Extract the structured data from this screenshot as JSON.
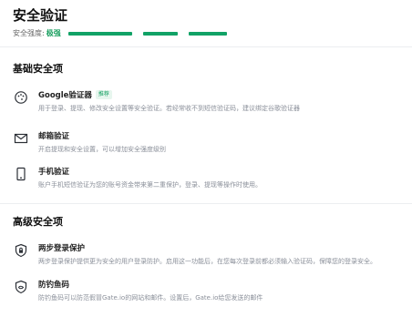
{
  "page": {
    "title": "安全验证",
    "strength_label": "安全强度:",
    "strength_value": "极强",
    "strength_level_bars": 3
  },
  "colors": {
    "accent": "#11a266",
    "badge_bg": "#e7f6ee",
    "muted_text": "#8a8f99"
  },
  "basic": {
    "title": "基础安全项",
    "items": [
      {
        "icon": "google-authenticator-icon",
        "name": "Google验证器",
        "badge": "推荐",
        "desc": "用于登录、提现、修改安全设置等安全验证。若经常收不到短信验证码，建议绑定谷歌验证器"
      },
      {
        "icon": "mail-icon",
        "name": "邮箱验证",
        "desc": "开启提现和安全设置，可以增加安全强度级别"
      },
      {
        "icon": "phone-icon",
        "name": "手机验证",
        "desc": "账户手机短信验证为您的账号资金带来第二重保护，登录、提现等操作时使用。"
      }
    ]
  },
  "advanced": {
    "title": "高级安全项",
    "items": [
      {
        "icon": "shield-lock-icon",
        "name": "两步登录保护",
        "desc": "两步登录保护提供更为安全的用户登录防护。启用这一功能后，在您每次登录前都必须输入验证码，保障您的登录安全。"
      },
      {
        "icon": "anti-phishing-shield-icon",
        "name": "防钓鱼码",
        "desc": "防钓鱼码可以防范假冒Gate.io的网站和邮件。设置后，Gate.io给您发送的邮件"
      }
    ]
  }
}
